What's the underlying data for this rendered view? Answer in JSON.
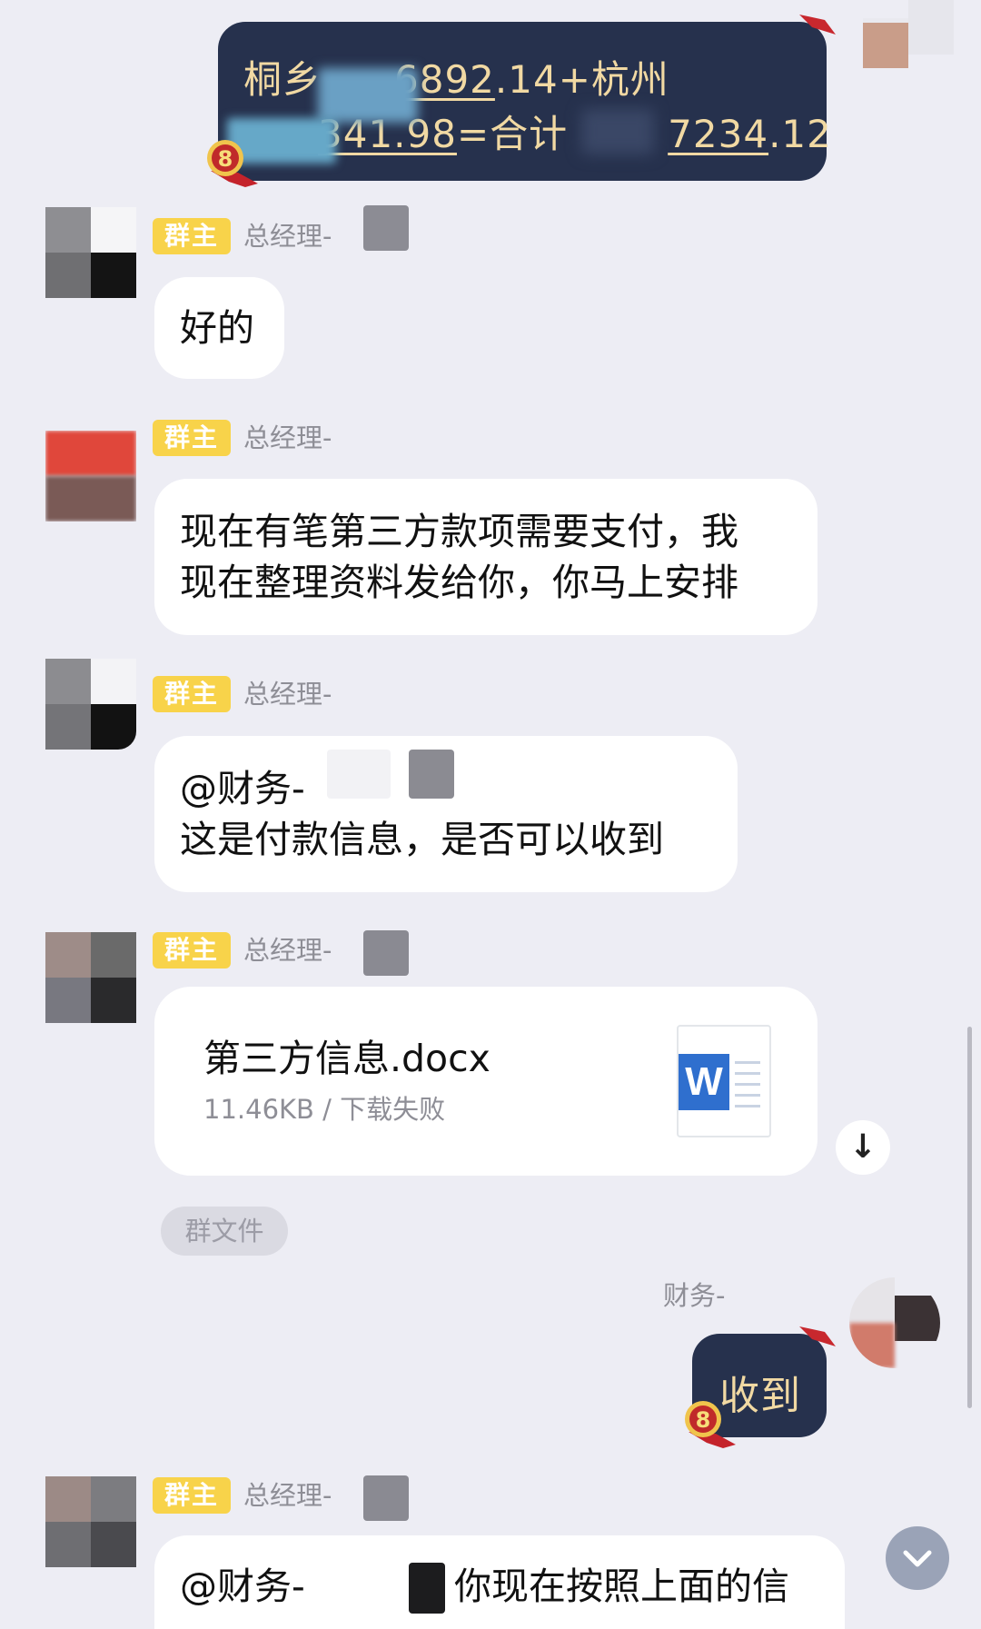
{
  "messages": {
    "top_bubble": {
      "line1_prefix": "桐乡",
      "line1_amount": "6892",
      "line1_suffix": ".14+杭州",
      "line2_amount": "341.98",
      "line2_mid": "=合计",
      "line2_total": "7234",
      "line2_total_suffix": ".12"
    },
    "role_badge": "群主",
    "sender_manager": "总经理-",
    "msg1": "好的",
    "msg2_line1": "现在有笔第三方款项需要支付，我",
    "msg2_line2": "现在整理资料发给你，你马上安排",
    "msg3_line1": "@财务-",
    "msg3_line2": "这是付款信息，是否可以收到",
    "file": {
      "name": "第三方信息.docx",
      "meta": "11.46KB / 下载失败",
      "icon_letter": "W"
    },
    "group_file_label": "群文件",
    "sender_finance": "财务-",
    "reply": "收到",
    "msg5_at": "@财务-",
    "msg5_text": "你现在按照上面的信",
    "download_symbol": "↓",
    "level_badge": "8"
  },
  "colors": {
    "background": "#ededf4",
    "dark_bubble": "#26314d",
    "dark_bubble_text": "#f1d9a3",
    "badge": "#f8d34a",
    "word_blue": "#2f6fce"
  }
}
